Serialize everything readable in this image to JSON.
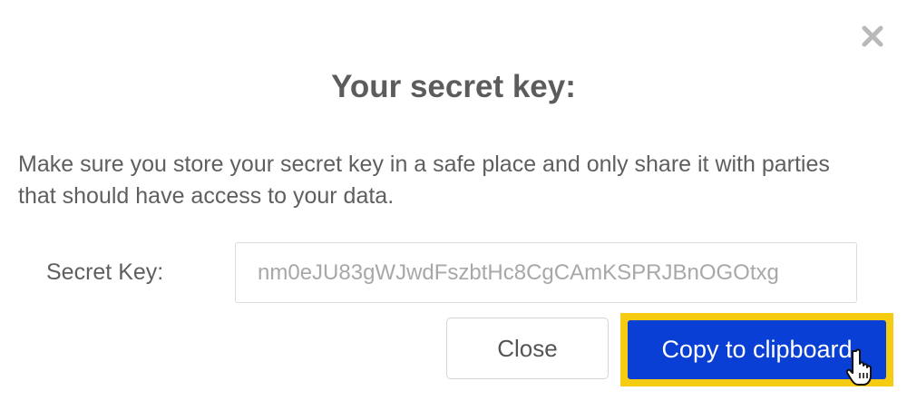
{
  "dialog": {
    "title": "Your secret key:",
    "message": "Make sure you store your secret key in a safe place and only share it with parties that should have access to your data.",
    "close_icon": "close-x-icon"
  },
  "secret_key": {
    "label": "Secret Key:",
    "value": "nm0eJU83gWJwdFszbtHc8CgCAmKSPRJBnOGOtxg"
  },
  "buttons": {
    "close_label": "Close",
    "copy_label": "Copy to clipboard"
  },
  "colors": {
    "primary": "#0a3fd6",
    "highlight": "#f5cc12",
    "title_text": "#5c5c5c",
    "body_text": "#5f5f5f"
  },
  "cursor_icon": "hand-pointer-icon"
}
